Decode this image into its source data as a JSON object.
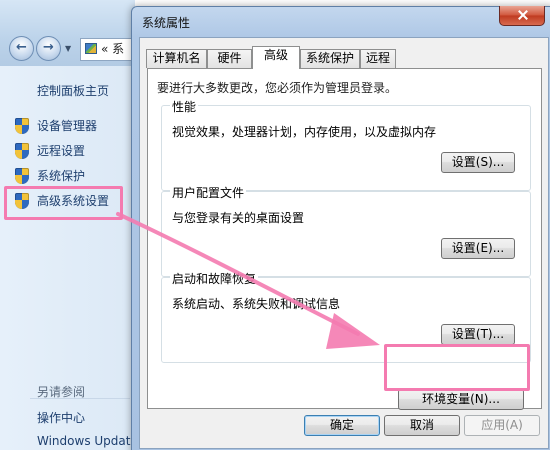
{
  "control_panel": {
    "address_text": "«  系",
    "sidebar": {
      "home": "控制面板主页",
      "links": [
        "设备管理器",
        "远程设置",
        "系统保护",
        "高级系统设置"
      ],
      "see_also_header": "另请参阅",
      "see_also": [
        "操作中心",
        "Windows Update"
      ]
    }
  },
  "dialog": {
    "title": "系统属性",
    "tabs": [
      "计算机名",
      "硬件",
      "高级",
      "系统保护",
      "远程"
    ],
    "active_tab": "高级",
    "notice": "要进行大多数更改，您必须作为管理员登录。",
    "groups": {
      "performance": {
        "legend": "性能",
        "desc": "视觉效果，处理器计划，内存使用，以及虚拟内存",
        "button": "设置(S)..."
      },
      "profiles": {
        "legend": "用户配置文件",
        "desc": "与您登录有关的桌面设置",
        "button": "设置(E)..."
      },
      "startup": {
        "legend": "启动和故障恢复",
        "desc": "系统启动、系统失败和调试信息",
        "button": "设置(T)..."
      }
    },
    "env_button": "环境变量(N)...",
    "ok_button": "确定",
    "cancel_button": "取消",
    "apply_button": "应用(A)"
  },
  "colors": {
    "highlight": "#f47bb0",
    "link_text": "#1e3f6e",
    "dialog_frame": "#a8c2e2"
  }
}
